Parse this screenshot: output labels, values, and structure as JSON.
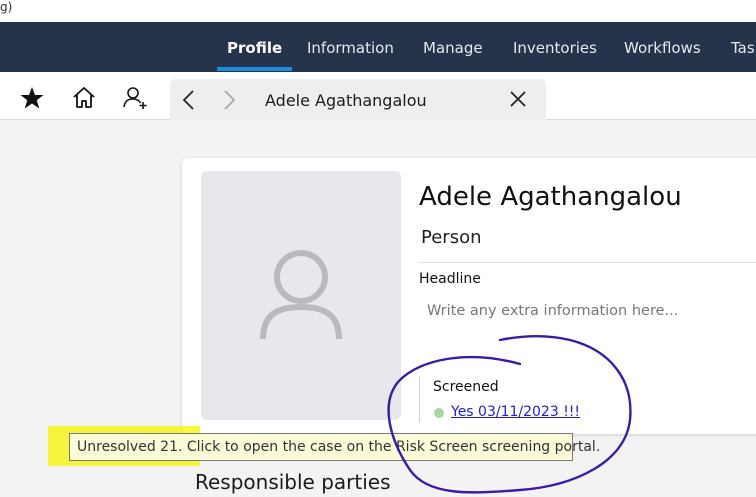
{
  "window": {
    "title_fragment": "g)"
  },
  "nav": {
    "tabs": [
      {
        "label": "Profile",
        "active": true
      },
      {
        "label": "Information",
        "active": false
      },
      {
        "label": "Manage",
        "active": false
      },
      {
        "label": "Inventories",
        "active": false
      },
      {
        "label": "Workflows",
        "active": false
      },
      {
        "label": "Tasks",
        "active": false
      }
    ]
  },
  "toolbar": {
    "icons": [
      "star-icon",
      "home-icon",
      "add-person-icon",
      "chevron-left-icon",
      "chevron-right-icon",
      "close-icon"
    ],
    "record_title": "Adele Agathangalou"
  },
  "profile": {
    "name": "Adele Agathangalou",
    "type": "Person",
    "headline_label": "Headline",
    "headline_placeholder": "Write any extra information here...",
    "screened_label": "Screened",
    "screened_value": "Yes 03/11/2023 !!!",
    "screened_status_color": "#a8d5a2"
  },
  "tooltip": {
    "text": "Unresolved 21. Click to open the case on the Risk Screen screening portal."
  },
  "section": {
    "heading": "Responsible parties"
  },
  "colors": {
    "nav_bg": "#26344b",
    "accent": "#1a8ce0",
    "annotation": "#3a1aa8",
    "highlight": "#f5f500"
  }
}
